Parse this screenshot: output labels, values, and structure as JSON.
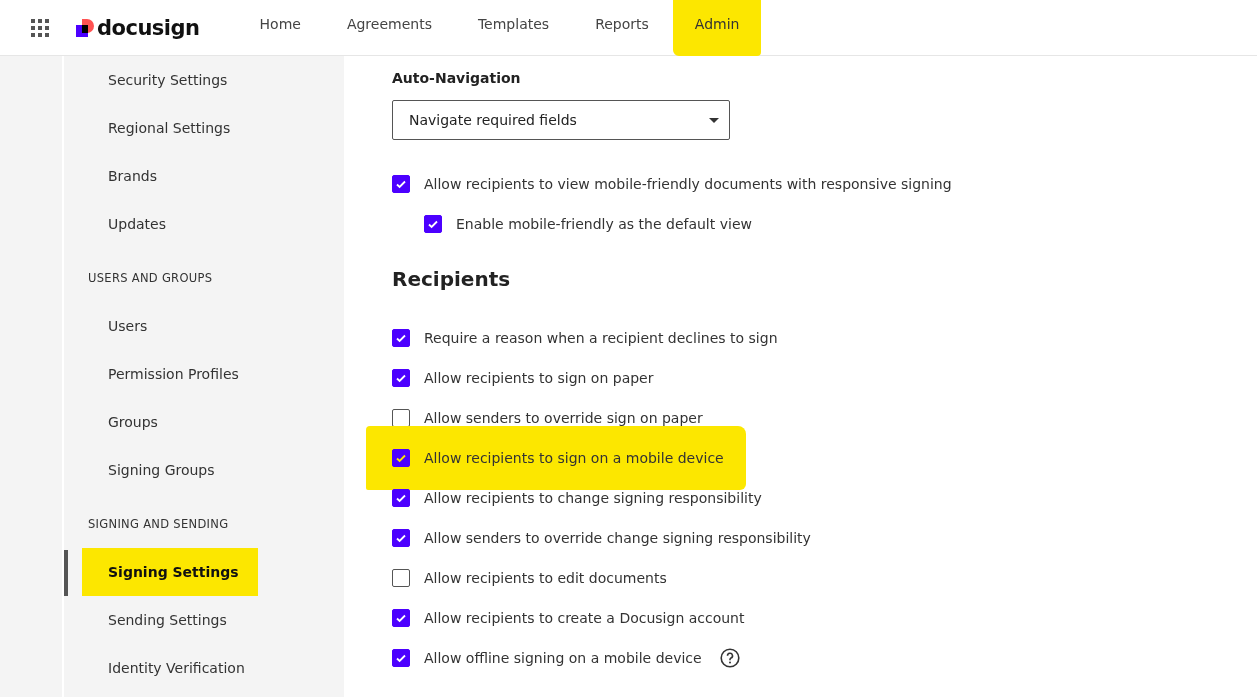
{
  "header": {
    "logo": "docusign",
    "nav": [
      {
        "label": "Home",
        "selected": false,
        "highlighted": false
      },
      {
        "label": "Agreements",
        "selected": false,
        "highlighted": false
      },
      {
        "label": "Templates",
        "selected": false,
        "highlighted": false
      },
      {
        "label": "Reports",
        "selected": false,
        "highlighted": false
      },
      {
        "label": "Admin",
        "selected": true,
        "highlighted": true
      }
    ]
  },
  "sidebar": {
    "sections": [
      {
        "items": [
          {
            "label": "Security Settings",
            "selected": false,
            "highlighted": false
          },
          {
            "label": "Regional Settings",
            "selected": false,
            "highlighted": false
          },
          {
            "label": "Brands",
            "selected": false,
            "highlighted": false
          },
          {
            "label": "Updates",
            "selected": false,
            "highlighted": false
          }
        ]
      },
      {
        "heading": "USERS AND GROUPS",
        "items": [
          {
            "label": "Users",
            "selected": false,
            "highlighted": false
          },
          {
            "label": "Permission Profiles",
            "selected": false,
            "highlighted": false
          },
          {
            "label": "Groups",
            "selected": false,
            "highlighted": false
          },
          {
            "label": "Signing Groups",
            "selected": false,
            "highlighted": false
          }
        ]
      },
      {
        "heading": "SIGNING AND SENDING",
        "items": [
          {
            "label": "Signing Settings",
            "selected": true,
            "highlighted": true
          },
          {
            "label": "Sending Settings",
            "selected": false,
            "highlighted": false
          },
          {
            "label": "Identity Verification",
            "selected": false,
            "highlighted": false
          }
        ]
      }
    ]
  },
  "main": {
    "auto_navigation": {
      "label": "Auto-Navigation",
      "value": "Navigate required fields"
    },
    "mobile_options": [
      {
        "label": "Allow recipients to view mobile-friendly documents with responsive signing",
        "checked": true,
        "highlighted": false,
        "children": [
          {
            "label": "Enable mobile-friendly as the default view",
            "checked": true,
            "highlighted": false
          }
        ]
      }
    ],
    "recipients": {
      "heading": "Recipients",
      "options": [
        {
          "label": "Require a reason when a recipient declines to sign",
          "checked": true,
          "highlighted": false,
          "help": false
        },
        {
          "label": "Allow recipients to sign on paper",
          "checked": true,
          "highlighted": false,
          "help": false
        },
        {
          "label": "Allow senders to override sign on paper",
          "checked": false,
          "highlighted": false,
          "help": false
        },
        {
          "label": "Allow recipients to sign on a mobile device",
          "checked": true,
          "highlighted": true,
          "help": false
        },
        {
          "label": "Allow recipients to change signing responsibility",
          "checked": true,
          "highlighted": false,
          "help": false
        },
        {
          "label": "Allow senders to override change signing responsibility",
          "checked": true,
          "highlighted": false,
          "help": false
        },
        {
          "label": "Allow recipients to edit documents",
          "checked": false,
          "highlighted": false,
          "help": false
        },
        {
          "label": "Allow recipients to create a Docusign account",
          "checked": true,
          "highlighted": false,
          "help": false
        },
        {
          "label": "Allow offline signing on a mobile device",
          "checked": true,
          "highlighted": false,
          "help": true
        }
      ]
    }
  }
}
